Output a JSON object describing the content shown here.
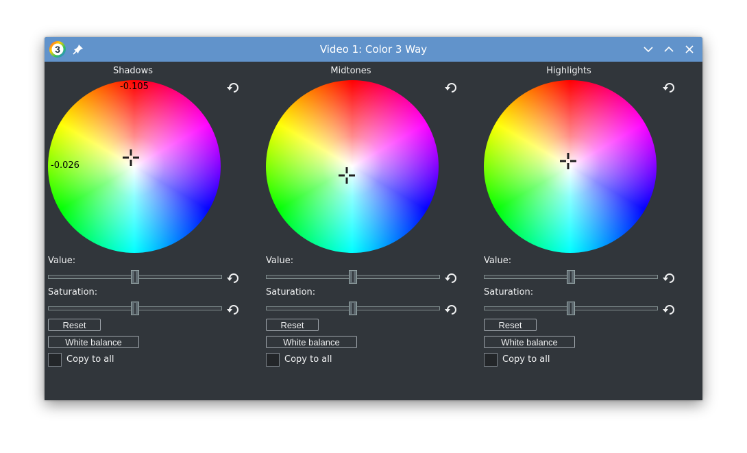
{
  "window": {
    "title": "Video 1: Color 3 Way",
    "app_icon_glyph": "3",
    "icons": {
      "app": "cinelerra-app-icon",
      "pin": "pin-icon",
      "minimize": "chevron-down-icon",
      "maximize": "chevron-up-icon",
      "close": "close-icon"
    }
  },
  "panels": [
    {
      "title": "Shadows",
      "wheel_labels": {
        "top": "-0.105",
        "left": "-0.026"
      },
      "crosshair": {
        "x_fraction": 0.48,
        "y_fraction": 0.45
      },
      "value_label": "Value:",
      "value_position": 0.5,
      "saturation_label": "Saturation:",
      "saturation_position": 0.5,
      "reset_label": "Reset",
      "white_balance_label": "White balance",
      "copy_label": "Copy to all",
      "copy_checked": false
    },
    {
      "title": "Midtones",
      "wheel_labels": {
        "top": "",
        "left": ""
      },
      "crosshair": {
        "x_fraction": 0.47,
        "y_fraction": 0.55
      },
      "value_label": "Value:",
      "value_position": 0.5,
      "saturation_label": "Saturation:",
      "saturation_position": 0.5,
      "reset_label": "Reset",
      "white_balance_label": "White balance",
      "copy_label": "Copy to all",
      "copy_checked": false
    },
    {
      "title": "Highlights",
      "wheel_labels": {
        "top": "",
        "left": ""
      },
      "crosshair": {
        "x_fraction": 0.49,
        "y_fraction": 0.47
      },
      "value_label": "Value:",
      "value_position": 0.5,
      "saturation_label": "Saturation:",
      "saturation_position": 0.5,
      "reset_label": "Reset",
      "white_balance_label": "White balance",
      "copy_label": "Copy to all",
      "copy_checked": false
    }
  ],
  "colors": {
    "titlebar": "#6193cb",
    "window_bg": "#31363b",
    "text": "#eff0f1"
  }
}
